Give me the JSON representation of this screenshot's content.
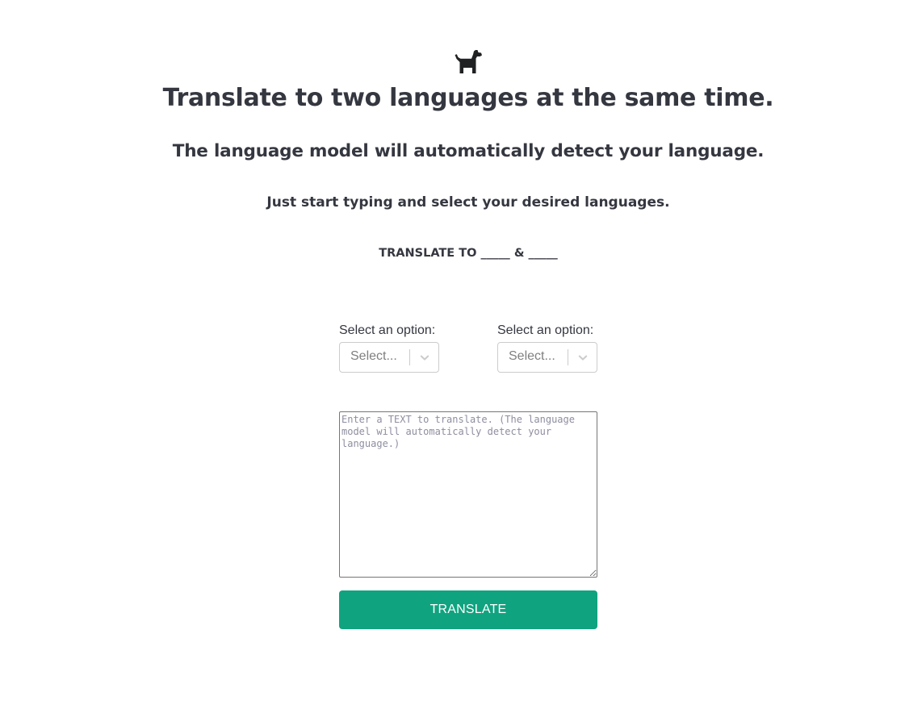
{
  "header": {
    "logo_icon": "dog-icon",
    "title": "Translate to two languages at the same time.",
    "subtitle": "The language model will automatically detect your language.",
    "hint": "Just start typing and select your desired languages.",
    "translate_to": "TRANSLATE TO _____ & _____"
  },
  "selects": [
    {
      "label": "Select an option:",
      "placeholder": "Select...",
      "chevron_icon": "chevron-down-icon"
    },
    {
      "label": "Select an option:",
      "placeholder": "Select...",
      "chevron_icon": "chevron-down-icon"
    }
  ],
  "text_input": {
    "value": "",
    "placeholder": "Enter a TEXT to translate. (The language model will automatically detect your language.)"
  },
  "translate_button": {
    "label": "TRANSLATE"
  },
  "colors": {
    "text": "#353740",
    "accent": "#10a37f",
    "select_border": "#cccccc",
    "placeholder": "#808080"
  }
}
